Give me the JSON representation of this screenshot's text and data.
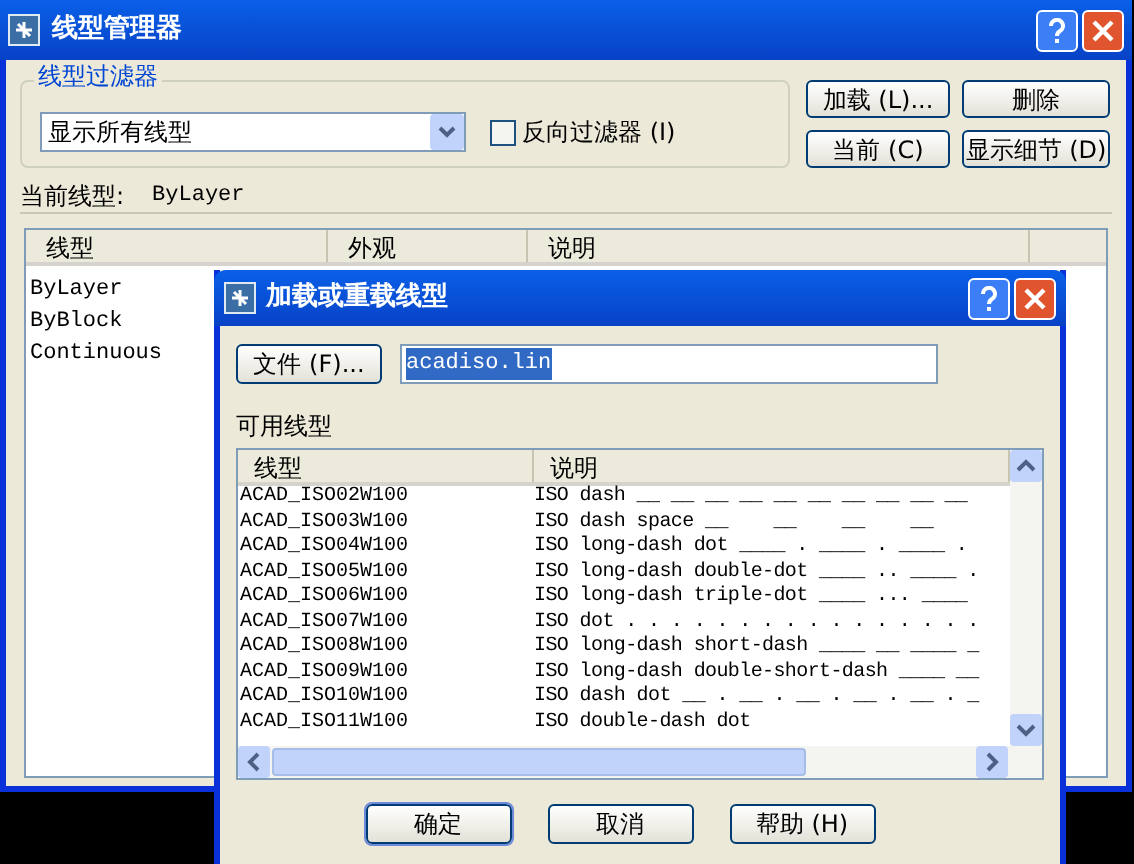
{
  "window": {
    "title": "线型管理器"
  },
  "filter": {
    "label": "线型过滤器",
    "value": "显示所有线型"
  },
  "invert_filter": {
    "label": "反向过滤器 (I)",
    "checked": false
  },
  "buttons": [
    {
      "label": "加载 (L)..."
    },
    {
      "label": "删除"
    },
    {
      "label": "当前 (C)"
    },
    {
      "label": "显示细节 (D)"
    }
  ],
  "current": {
    "label": "当前线型:",
    "value": "ByLayer"
  },
  "table": {
    "columns": [
      "线型",
      "外观",
      "说明"
    ],
    "rows": [
      {
        "linetype": "ByLayer"
      },
      {
        "linetype": "ByBlock"
      },
      {
        "linetype": "Continuous"
      }
    ]
  },
  "dialog": {
    "title": "加载或重载线型",
    "file_button": "文件 (F)...",
    "file_field": {
      "value": "acadiso.lin",
      "selected": true
    },
    "list_label": "可用线型",
    "columns": [
      "线型",
      "说明"
    ],
    "rows": [
      {
        "linetype": "ACAD_ISO02W100",
        "description": "ISO dash __ __ __ __ __ __ __ __ __ __"
      },
      {
        "linetype": "ACAD_ISO03W100",
        "description": "ISO dash space __    __    __    __"
      },
      {
        "linetype": "ACAD_ISO04W100",
        "description": "ISO long-dash dot ____ . ____ . ____ ."
      },
      {
        "linetype": "ACAD_ISO05W100",
        "description": "ISO long-dash double-dot ____ .. ____ ."
      },
      {
        "linetype": "ACAD_ISO06W100",
        "description": "ISO long-dash triple-dot ____ ... ____"
      },
      {
        "linetype": "ACAD_ISO07W100",
        "description": "ISO dot . . . . . . . . . . . . . . . ."
      },
      {
        "linetype": "ACAD_ISO08W100",
        "description": "ISO long-dash short-dash ____ __ ____ _"
      },
      {
        "linetype": "ACAD_ISO09W100",
        "description": "ISO long-dash double-short-dash ____ __"
      },
      {
        "linetype": "ACAD_ISO10W100",
        "description": "ISO dash dot __ . __ . __ . __ . __ . _"
      },
      {
        "linetype": "ACAD_ISO11W100",
        "description": "ISO double-dash dot"
      }
    ],
    "buttons": [
      {
        "label": "确定",
        "default": true
      },
      {
        "label": "取消",
        "default": false
      },
      {
        "label": "帮助 (H)",
        "default": false
      }
    ]
  }
}
